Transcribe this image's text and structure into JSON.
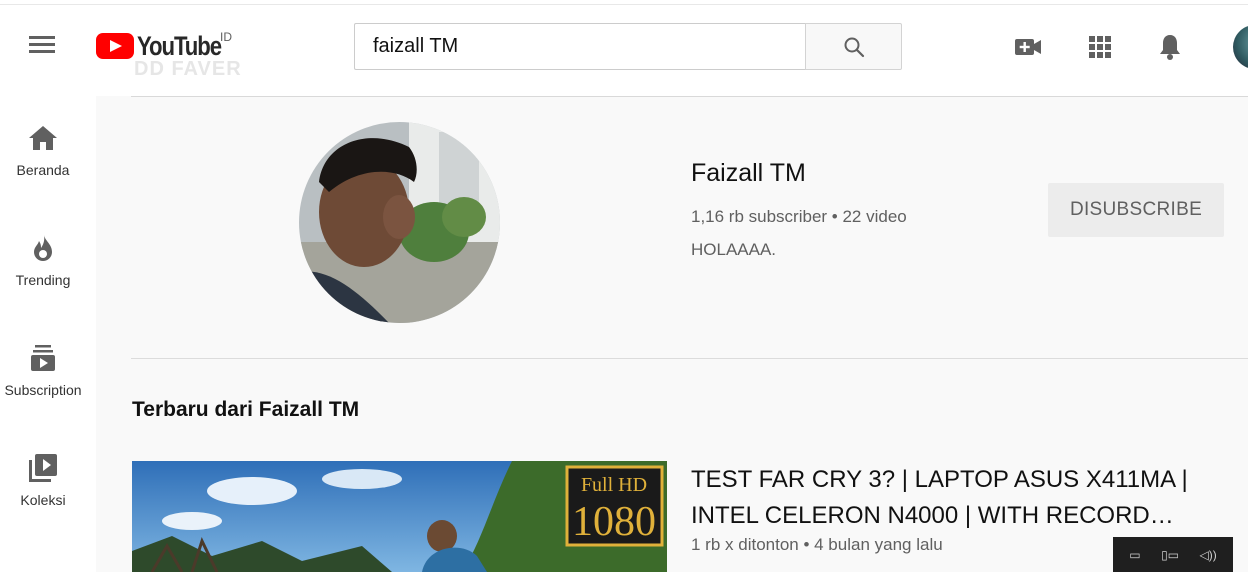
{
  "header": {
    "logo_text": "YouTube",
    "country_code": "ID",
    "ghost_text": "DD FAVER",
    "search_value": "faizall TM"
  },
  "sidebar": {
    "items": [
      {
        "label": "Beranda",
        "icon": "home-icon"
      },
      {
        "label": "Trending",
        "icon": "fire-icon"
      },
      {
        "label": "Subscription",
        "icon": "subscriptions-icon"
      },
      {
        "label": "Koleksi",
        "icon": "library-icon"
      }
    ]
  },
  "channel": {
    "name": "Faizall TM",
    "meta": "1,16 rb subscriber • 22 video",
    "description": "HOLAAAA.",
    "unsubscribe_label": "DISUBSCRIBE"
  },
  "section": {
    "title": "Terbaru dari Faizall TM"
  },
  "video": {
    "title": "TEST FAR CRY 3? | LAPTOP ASUS X411MA | INTEL CELERON N4000 | WITH RECORD…",
    "meta": "1 rb x ditonton • 4 bulan yang lalu",
    "badge_top": "Full HD",
    "badge_bottom": "1080"
  },
  "colors": {
    "brand_red": "#ff0000",
    "icon_gray": "#606060"
  }
}
